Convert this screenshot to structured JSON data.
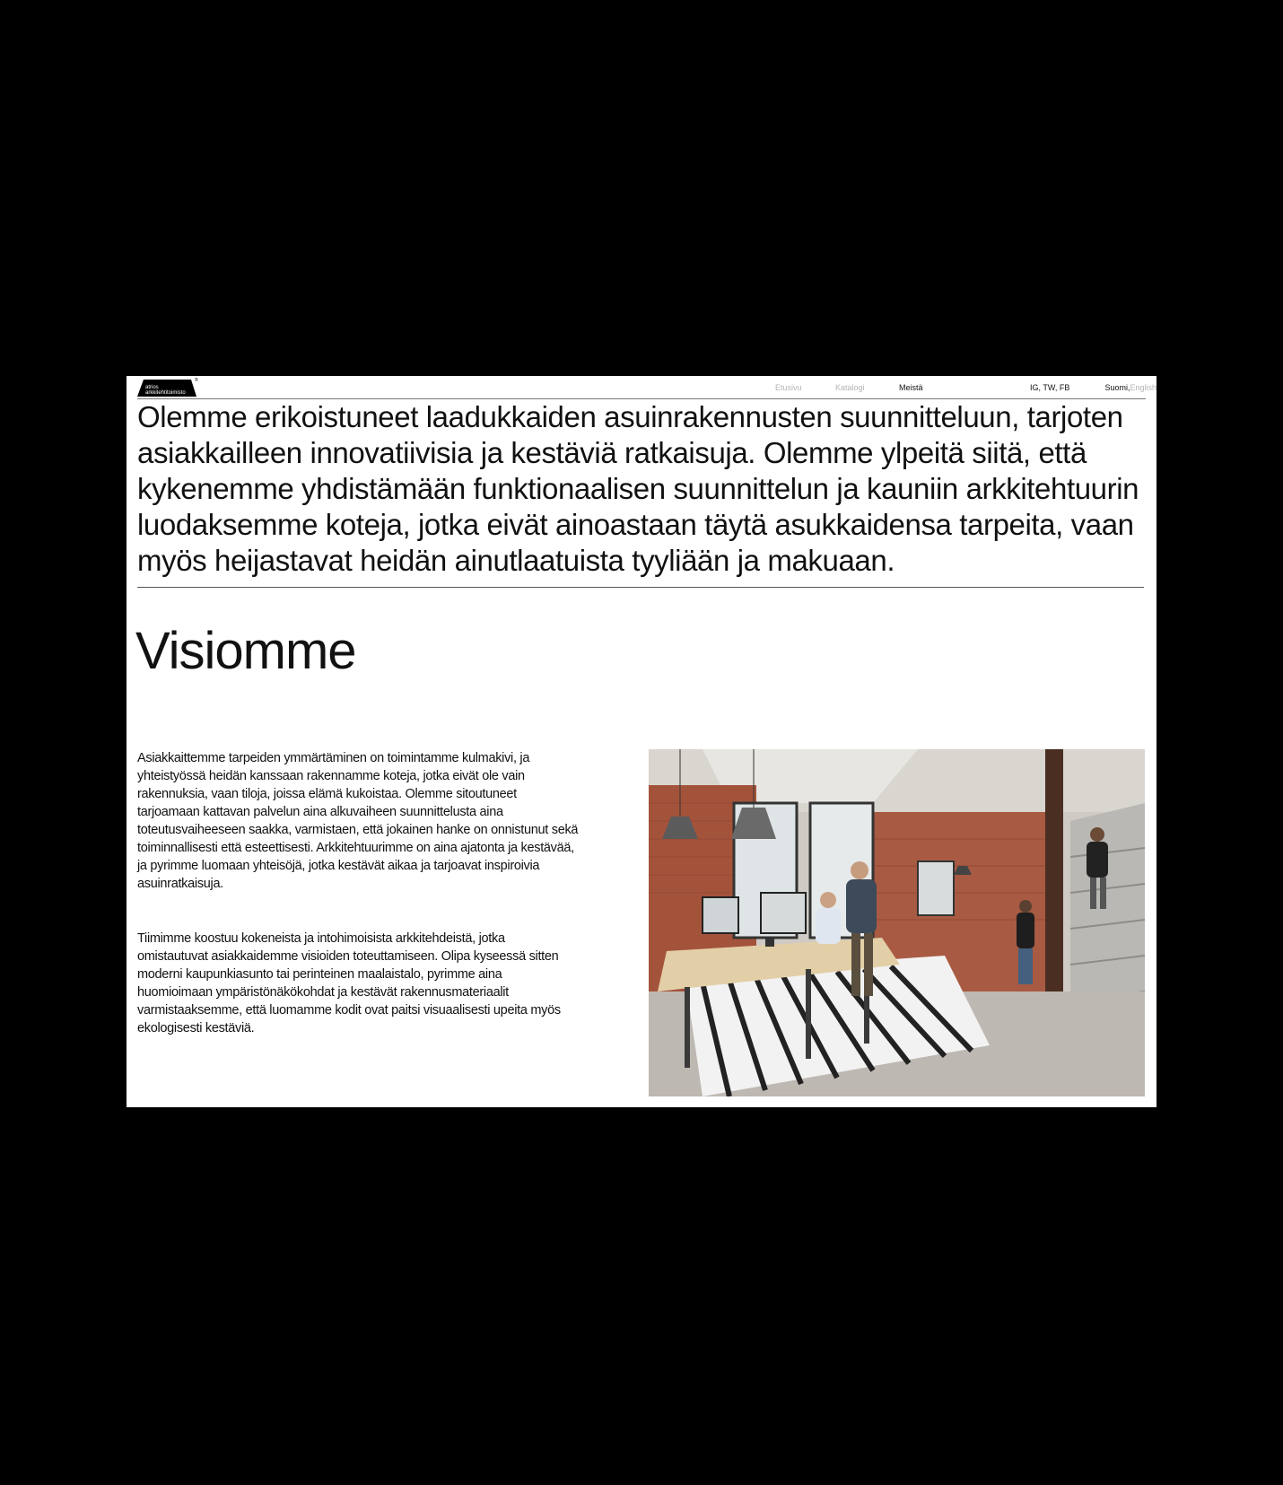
{
  "logo": {
    "line1": "atrios",
    "line2": "arkkitehtitoimisto",
    "mark": "®"
  },
  "nav": {
    "items": [
      {
        "label": "Etusivu",
        "state": "inactive"
      },
      {
        "label": "Katalogi",
        "state": "inactive"
      },
      {
        "label": "Meistä",
        "state": "active"
      }
    ],
    "social": "IG, TW, FB",
    "lang_current": "Suomi,",
    "lang_other": "English"
  },
  "intro": "Olemme erikoistuneet laadukkaiden asuinrakennusten suunnitteluun, tarjoten asiakkailleen innovatiivisia ja kestäviä ratkaisuja. Olemme ylpeitä siitä, että kykenemme yhdistämään funktionaalisen suunnittelun ja kauniin arkkitehtuurin luodaksemme koteja, jotka eivät ainoastaan täytä asukkaidensa tarpeita, vaan myös heijastavat heidän ainutlaatuista tyyliään ja makuaan.",
  "section": {
    "heading": "Visiomme",
    "paragraph1": "Asiakkaittemme tarpeiden ymmärtäminen on toimintamme kulmakivi, ja yhteistyössä heidän kanssaan rakennamme koteja, jotka eivät ole vain rakennuksia, vaan tiloja, joissa elämä kukoistaa. Olemme sitoutuneet tarjoamaan kattavan palvelun aina alkuvaiheen suunnittelusta aina toteutusvaiheeseen saakka, varmistaen, että jokainen hanke on onnistunut sekä toiminnallisesti että esteettisesti. Arkkitehtuurimme on aina ajatonta ja kestävää, ja pyrimme luomaan yhteisöjä, jotka kestävät aikaa ja tarjoavat inspiroivia asuinratkaisuja.",
    "paragraph2": "Tiimimme koostuu kokeneista ja intohimoisista arkkitehdeistä, jotka omistautuvat asiakkaidemme visioiden toteuttamiseen. Olipa kyseessä sitten moderni kaupunkiasunto tai perinteinen maalaistalo, pyrimme aina huomioimaan ympäristönäkökohdat ja kestävät rakennusmateriaalit varmistaaksemme, että luomamme kodit ovat paitsi visuaalisesti upeita myös ekologisesti kestäviä."
  },
  "colors": {
    "page_bg": "#ffffff",
    "outer_bg": "#000000",
    "text": "#111111",
    "nav_inactive": "#b5b5b5"
  }
}
